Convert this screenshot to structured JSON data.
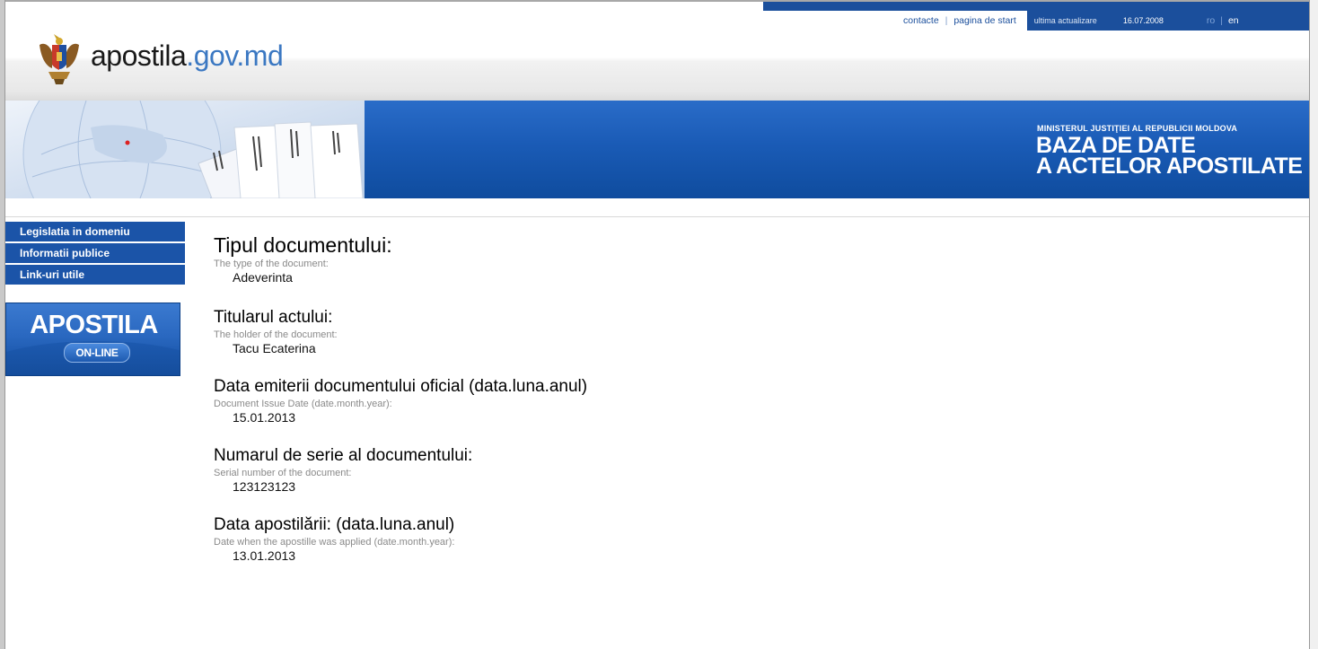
{
  "topbar": {
    "contacts": "contacte",
    "home": "pagina de start",
    "last_update_label": "ultima actualizare",
    "last_update_date": "16.07.2008",
    "lang_ro": "ro",
    "lang_separator": "|",
    "lang_en": "en"
  },
  "logo": {
    "name": "apostila",
    "domain": ".gov.md",
    "icon": "moldova-coat-of-arms-icon"
  },
  "banner": {
    "ministry": "MINISTERUL JUSTIŢIEI AL REPUBLICII MOLDOVA",
    "title_line1": "BAZA DE DATE",
    "title_line2": "A ACTELOR APOSTILATE"
  },
  "sidebar": {
    "items": [
      {
        "label": "Legislatia in domeniu"
      },
      {
        "label": "Informatii publice"
      },
      {
        "label": "Link-uri utile"
      }
    ],
    "apostila_banner": {
      "title": "APOSTILA",
      "badge": "ON-LINE"
    }
  },
  "document": {
    "fields": [
      {
        "heading": "Tipul documentului:",
        "sub": "The type of the document:",
        "value": "Adeverinta"
      },
      {
        "heading": "Titularul actului:",
        "sub": "The holder of the document:",
        "value": "Tacu Ecaterina"
      },
      {
        "heading": "Data emiterii documentului oficial (data.luna.anul)",
        "sub": "Document Issue Date (date.month.year):",
        "value": "15.01.2013"
      },
      {
        "heading": "Numarul de serie al documentului:",
        "sub": "Serial number of the document:",
        "value": "123123123"
      },
      {
        "heading": "Data apostilării: (data.luna.anul)",
        "sub": "Date when the apostille was applied (date.month.year):",
        "value": "13.01.2013"
      }
    ]
  },
  "colors": {
    "brand_blue": "#1b54a8",
    "domain_blue": "#3b78c2"
  }
}
